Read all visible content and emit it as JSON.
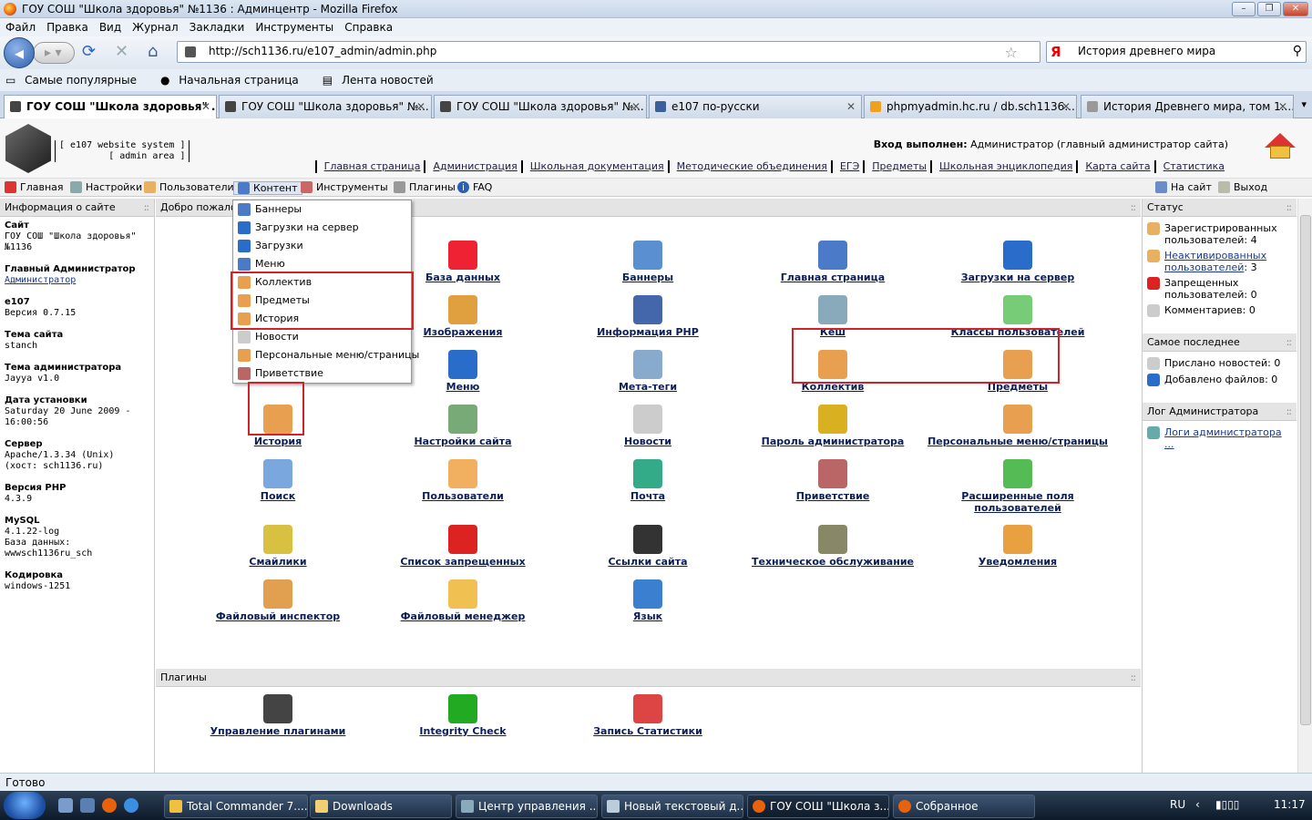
{
  "window": {
    "title": "ГОУ СОШ \"Школа здоровья\" №1136 : Админцентр - Mozilla Firefox"
  },
  "menu": [
    "Файл",
    "Правка",
    "Вид",
    "Журнал",
    "Закладки",
    "Инструменты",
    "Справка"
  ],
  "url": "http://sch1136.ru/e107_admin/admin.php",
  "search": "История древнего мира",
  "bookmarks": [
    "Самые популярные",
    "Начальная страница",
    "Лента новостей"
  ],
  "tabs": [
    "ГОУ СОШ \"Школа здоровья\" ...",
    "ГОУ СОШ \"Школа здоровья\" №...",
    "ГОУ СОШ \"Школа здоровья\" №...",
    "e107 по-русски",
    "phpmyadmin.hc.ru / db.sch1136....",
    "История Древнего мира, том 1...."
  ],
  "header": {
    "brand1": "[ e107 website system ]",
    "brand2": "[ admin area ]",
    "login_label": "Вход выполнен:",
    "login_user": " Администратор (главный администратор сайта)",
    "links": [
      "Главная страница",
      "Администрация",
      "Школьная документация",
      "Методические объединения",
      "ЕГЭ",
      "Предметы",
      "Школьная энциклопедия",
      "Карта сайта",
      "Статистика"
    ]
  },
  "adminnav": {
    "items": [
      "Главная",
      "Настройки",
      "Пользователи",
      "Контент",
      "Инструменты",
      "Плагины",
      "FAQ"
    ],
    "right": [
      "На сайт",
      "Выход"
    ]
  },
  "left": {
    "caption": "Информация о сайте",
    "blocks": [
      {
        "t": "Сайт",
        "v": "ГОУ СОШ \"Школа здоровья\"\n№1136"
      },
      {
        "t": "Главный Администратор",
        "v": "Администратор"
      },
      {
        "t": "e107",
        "v": "Версия 0.7.15"
      },
      {
        "t": "Тема сайта",
        "v": "stanch"
      },
      {
        "t": "Тема администратора",
        "v": "Jayya v1.0"
      },
      {
        "t": "Дата установки",
        "v": "Saturday 20 June 2009 -\n16:00:56"
      },
      {
        "t": "Сервер",
        "v": "Apache/1.3.34 (Unix)\n(хост: sch1136.ru)"
      },
      {
        "t": "Версия PHP",
        "v": "4.3.9"
      },
      {
        "t": "MySQL",
        "v": "4.1.22-log\nБаза данных:\nwwwsch1136ru_sch"
      },
      {
        "t": "Кодировка",
        "v": "windows-1251"
      }
    ]
  },
  "main": {
    "caption": "Добро пожало",
    "icons": [
      "База данных",
      "Баннеры",
      "Главная страница",
      "Загрузки на сервер",
      "Изображения",
      "Информация PHP",
      "Кеш",
      "Классы пользователей",
      "Меню",
      "Мета-теги",
      "Коллектив",
      "Предметы",
      "История",
      "Настройки сайта",
      "Новости",
      "Пароль администратора",
      "Персональные меню/страницы",
      "Поиск",
      "Пользователи",
      "Почта",
      "Приветствие",
      "Расширенные поля пользователей",
      "Смайлики",
      "Список запрещенных",
      "Ссылки сайта",
      "Техническое обслуживание",
      "Уведомления",
      "Файловый инспектор",
      "Файловый менеджер",
      "Язык"
    ],
    "plugins_caption": "Плагины",
    "plugins": [
      "Управление плагинами",
      "Integrity Check",
      "Запись Статистики"
    ]
  },
  "dropdown": [
    "Баннеры",
    "Загрузки на сервер",
    "Загрузки",
    "Меню",
    "Коллектив",
    "Предметы",
    "История",
    "Новости",
    "Персональные меню/страницы",
    "Приветствие"
  ],
  "right": {
    "status_caption": "Статус",
    "registered": "Зарегистрированных пользователей: 4",
    "inactive_link": "Неактивированных пользователей",
    "inactive_count": ": 3",
    "banned": "Запрещенных пользователей: 0",
    "comments": "Комментариев: 0",
    "latest_caption": "Самое последнее",
    "news": "Прислано новостей: 0",
    "files": "Добавлено файлов: 0",
    "log_caption": "Лог Администратора",
    "log_link": "Логи администратора ..."
  },
  "status": "Готово",
  "taskbar": {
    "items": [
      "Total Commander 7....",
      "Downloads",
      "Центр управления ...",
      "Новый текстовый д...",
      "ГОУ СОШ \"Школа з...",
      "Собранное"
    ],
    "lang": "RU",
    "time": "11:17"
  }
}
